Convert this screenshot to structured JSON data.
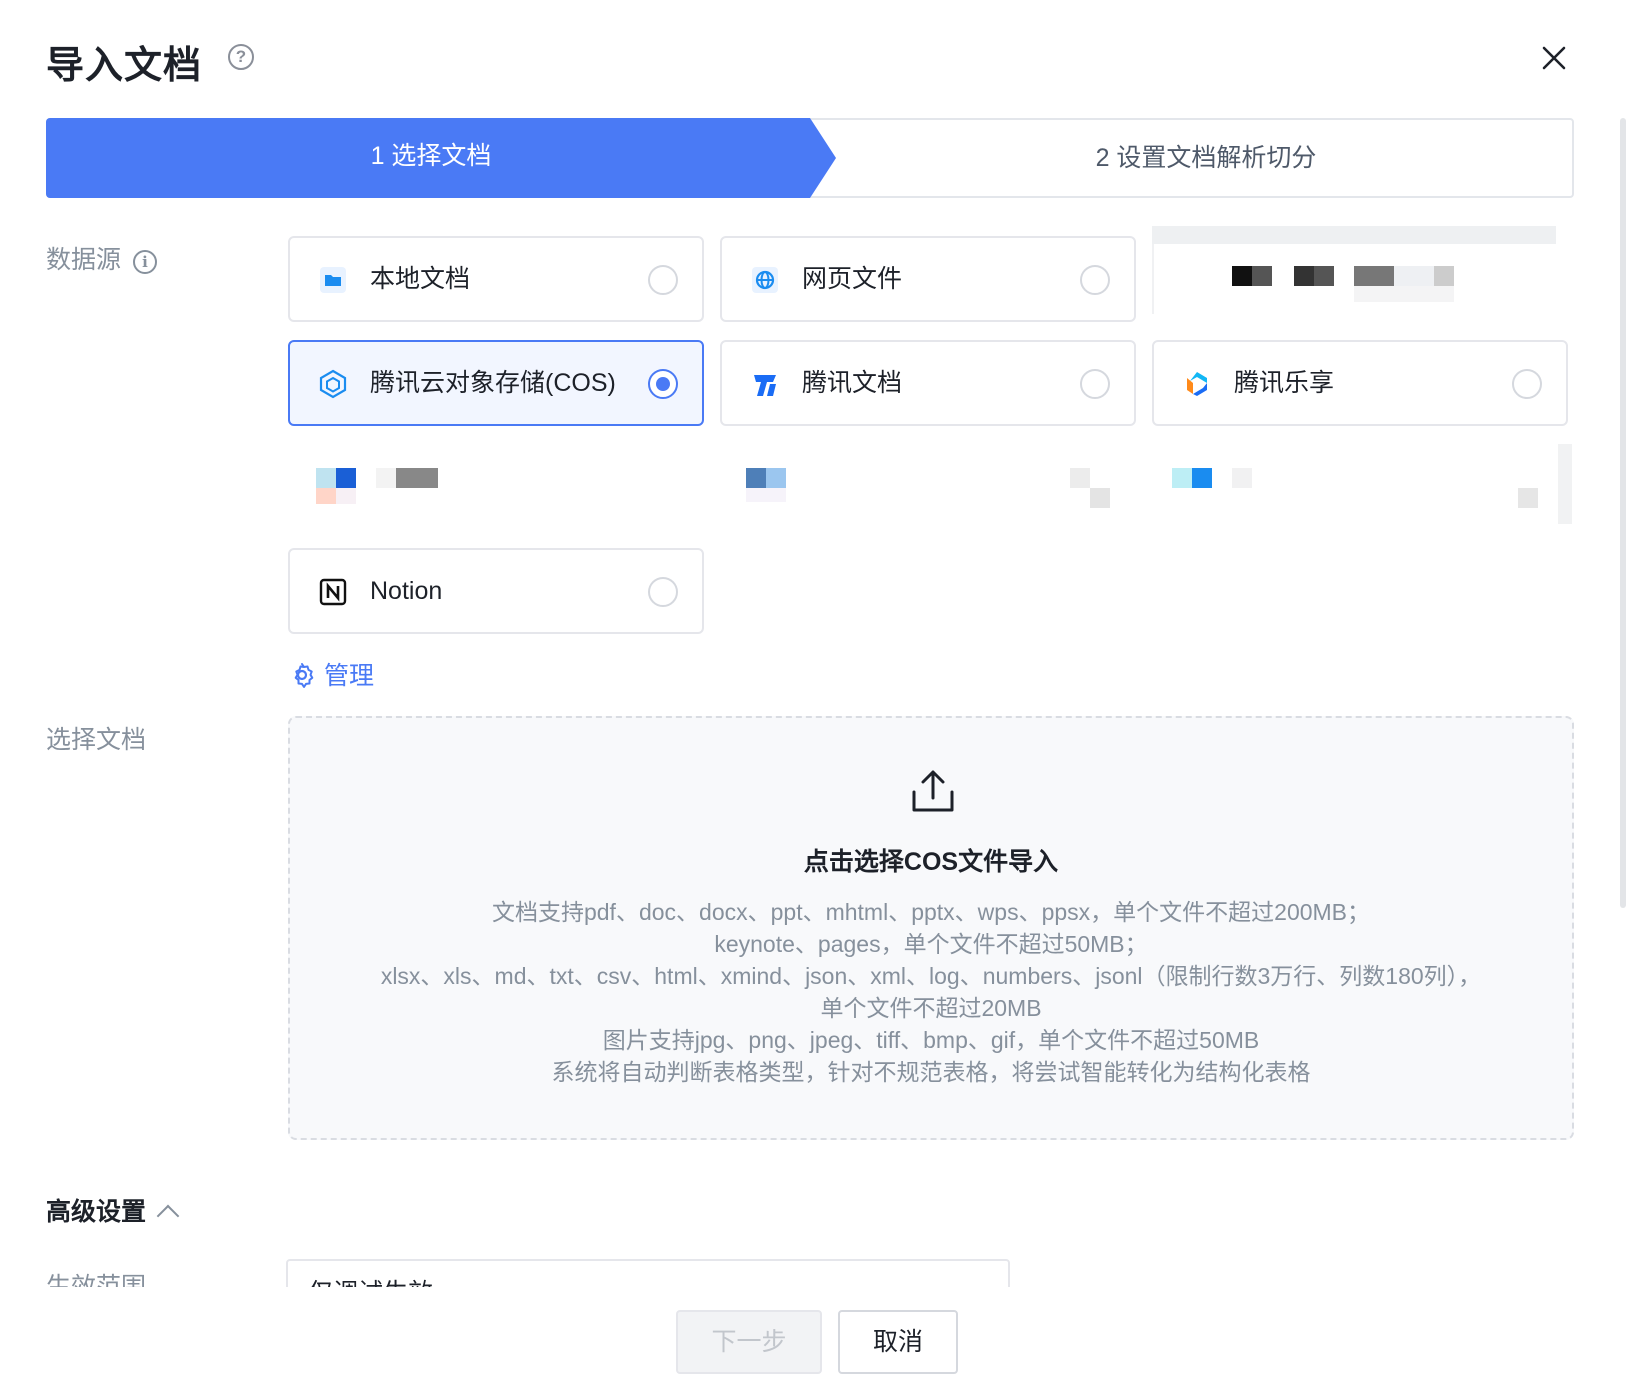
{
  "dialog": {
    "title": "导入文档",
    "help_icon": "question-circle-icon",
    "close_icon": "close-icon"
  },
  "steps": [
    {
      "label": "1 选择文档",
      "active": true
    },
    {
      "label": "2 设置文档解析切分",
      "active": false
    }
  ],
  "form": {
    "source_label": "数据源",
    "source_info_icon": "info-circle-icon",
    "sources": [
      {
        "label": "本地文档",
        "icon": "folder-icon",
        "selected": false
      },
      {
        "label": "网页文件",
        "icon": "globe-icon",
        "selected": false
      },
      {
        "label": "腾讯云对象存储(COS)",
        "icon": "cos-cube-icon",
        "selected": true
      },
      {
        "label": "腾讯文档",
        "icon": "tencent-docs-icon",
        "selected": false
      },
      {
        "label": "腾讯乐享",
        "icon": "tencent-lexiang-icon",
        "selected": false
      },
      {
        "label": "Notion",
        "icon": "notion-icon",
        "selected": false
      }
    ],
    "manage_label": "管理",
    "manage_icon": "gear-icon",
    "select_doc_label": "选择文档"
  },
  "upload": {
    "icon": "upload-icon",
    "title": "点击选择COS文件导入",
    "lines": [
      "文档支持pdf、doc、docx、ppt、mhtml、pptx、wps、ppsx，单个文件不超过200MB；",
      "keynote、pages，单个文件不超过50MB；",
      "xlsx、xls、md、txt、csv、html、xmind、json、xml、log、numbers、jsonl（限制行数3万行、列数180列），",
      "单个文件不超过20MB",
      "图片支持jpg、png、jpeg、tiff、bmp、gif，单个文件不超过50MB",
      "系统将自动判断表格类型，针对不规范表格，将尝试智能转化为结构化表格"
    ]
  },
  "advanced": {
    "label": "高级设置",
    "icon": "chevron-up-icon",
    "scope_label": "生效范围",
    "scope_value": "仅调试生效"
  },
  "footer": {
    "next_label": "下一步",
    "cancel_label": "取消"
  },
  "colors": {
    "accent": "#4a7af5",
    "selected_bg": "#f2f6ff"
  }
}
